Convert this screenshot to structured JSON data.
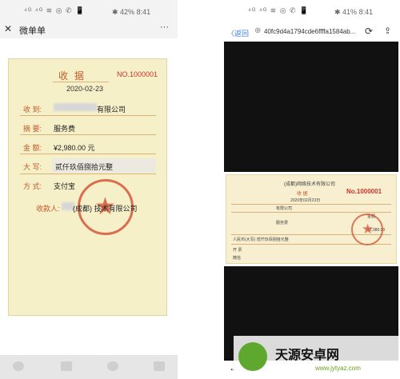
{
  "left_phone": {
    "status_bar": {
      "icons": "⁴ᴳ ⁴ᴳ ≋ ◎ ✆ 📱",
      "battery": "✱ 42%",
      "time": "8:41"
    },
    "nav": {
      "close_glyph": "✕",
      "title": "微单单",
      "more_glyph": "···"
    },
    "receipt": {
      "title": "收据",
      "number": "NO.1000001",
      "date": "2020-02-23",
      "fields": [
        {
          "label": "收 到:",
          "value": "有限公司"
        },
        {
          "label": "摘 要:",
          "value": "服务费"
        },
        {
          "label": "金 额:",
          "value": "¥2,980.00 元"
        },
        {
          "label": "大 写:",
          "value": "贰仟玖佰捌拾元整"
        },
        {
          "label": "方 式:",
          "value": "支付宝"
        }
      ],
      "payee_label": "收款人:",
      "payee_value": "(成都)      技术有限公司"
    }
  },
  "right_phone": {
    "status_bar": {
      "icons": "⁴ᴳ ⁴ᴳ ≋ ◎ ✆ 📱",
      "battery": "✱ 41%",
      "time": "8:41"
    },
    "nav": {
      "back_label": "〈返回",
      "url": "40fc9d4a1794cde6ffffa1584ab...",
      "reload_glyph": "⟳",
      "share_glyph": "⇪"
    },
    "receipt": {
      "company": "(成都)网络技术有限公司",
      "title": "收 据",
      "number": "No.1000001",
      "date": "2020年02月23日",
      "line1": "有限公司",
      "line2": "服务费",
      "amount_label": "金额",
      "amount": "¥2,980.00",
      "daxie": "人民币(大写) 贰仟玖佰捌拾元整",
      "row_label": "开 票",
      "method": "微信"
    },
    "back_glyph": "←"
  },
  "watermark": {
    "cn": "天源安卓网",
    "url": "www.jytyaz.com"
  }
}
